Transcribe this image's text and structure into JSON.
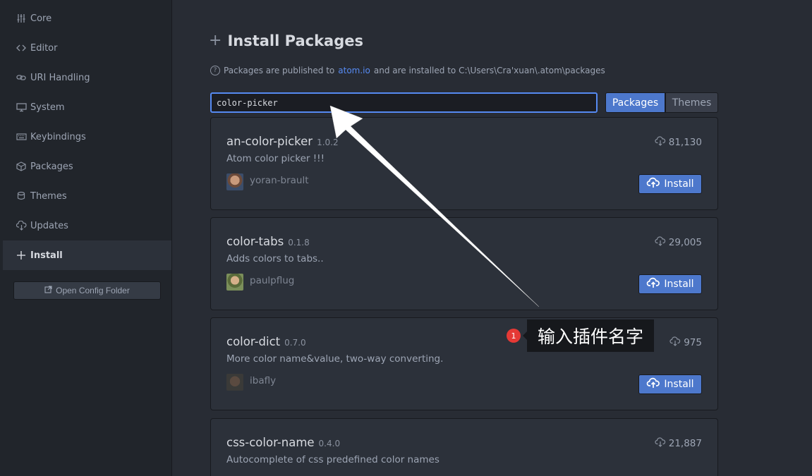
{
  "sidebar": {
    "items": [
      {
        "label": "Core",
        "icon": "sliders-icon"
      },
      {
        "label": "Editor",
        "icon": "code-icon"
      },
      {
        "label": "URI Handling",
        "icon": "link-icon"
      },
      {
        "label": "System",
        "icon": "monitor-icon"
      },
      {
        "label": "Keybindings",
        "icon": "keyboard-icon"
      },
      {
        "label": "Packages",
        "icon": "package-icon"
      },
      {
        "label": "Themes",
        "icon": "paintcan-icon"
      },
      {
        "label": "Updates",
        "icon": "cloud-download-icon"
      },
      {
        "label": "Install",
        "icon": "plus-icon",
        "active": true
      }
    ],
    "config_button": "Open Config Folder"
  },
  "main": {
    "title": "Install Packages",
    "hint_prefix": "Packages are published to",
    "hint_link": "atom.io",
    "hint_suffix": "and are installed to C:\\Users\\Cra'xuan\\.atom\\packages",
    "search_value": "color-picker",
    "toggle": {
      "packages": "Packages",
      "themes": "Themes",
      "selected": "Packages"
    },
    "install_label": "Install",
    "packages": [
      {
        "name": "an-color-picker",
        "version": "1.0.2",
        "description": "Atom color picker !!!",
        "author": "yoran-brault",
        "downloads": "81,130"
      },
      {
        "name": "color-tabs",
        "version": "0.1.8",
        "description": "Adds colors to tabs..",
        "author": "paulpflug",
        "downloads": "29,005"
      },
      {
        "name": "color-dict",
        "version": "0.7.0",
        "description": "More color name&value, two-way converting.",
        "author": "ibafly",
        "downloads": "975"
      },
      {
        "name": "css-color-name",
        "version": "0.4.0",
        "description": "Autocomplete of css predefined color names",
        "author": "",
        "downloads": "21,887"
      }
    ]
  },
  "annotation": {
    "badge": "1",
    "text": "输入插件名字"
  },
  "colors": {
    "accent": "#568af2",
    "button": "#4d78cc",
    "badge": "#e53935"
  }
}
